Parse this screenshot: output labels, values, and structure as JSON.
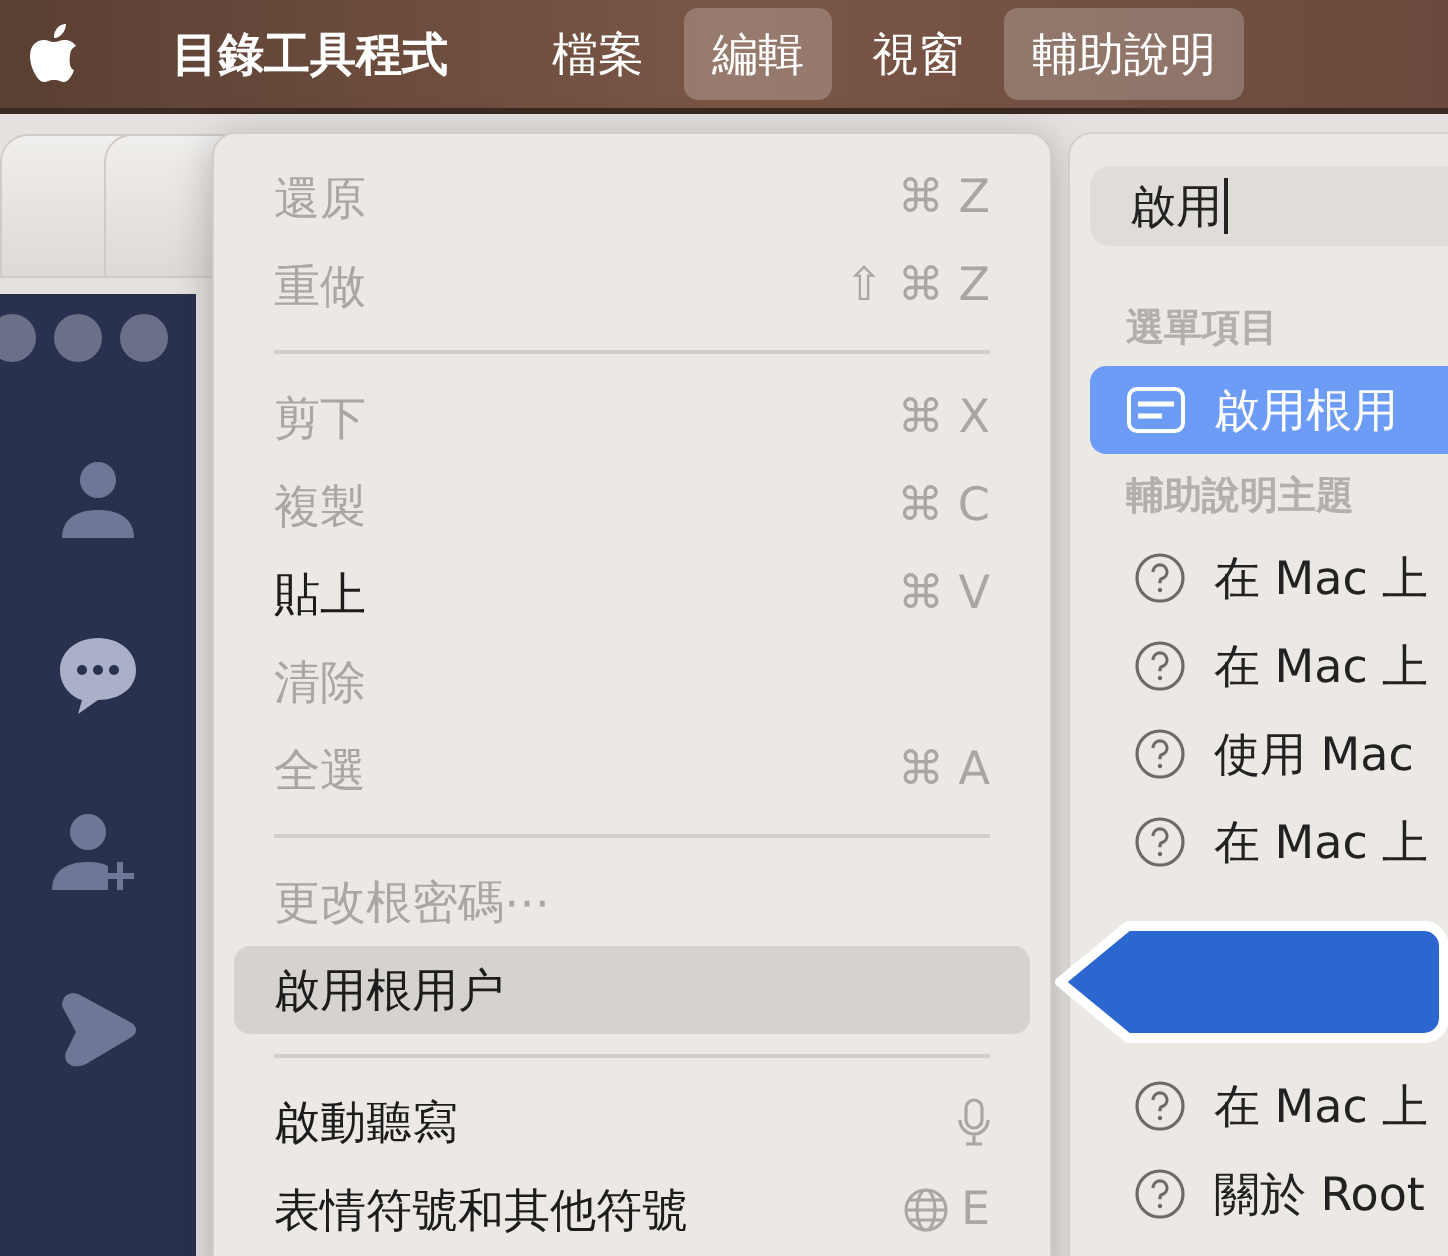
{
  "menu_bar": {
    "items": [
      {
        "label": "目錄工具程式",
        "kind": "app",
        "selected": false
      },
      {
        "label": "檔案",
        "kind": "menu",
        "selected": false
      },
      {
        "label": "編輯",
        "kind": "menu",
        "selected": true
      },
      {
        "label": "視窗",
        "kind": "menu",
        "selected": false
      },
      {
        "label": "輔助說明",
        "kind": "menu",
        "selected": true
      }
    ]
  },
  "edit_menu": {
    "items": [
      {
        "kind": "item",
        "label": "還原",
        "shortcut": "⌘ Z",
        "disabled": true,
        "highlighted": false
      },
      {
        "kind": "item",
        "label": "重做",
        "shortcut": "⇧ ⌘ Z",
        "disabled": true,
        "highlighted": false
      },
      {
        "kind": "separator"
      },
      {
        "kind": "item",
        "label": "剪下",
        "shortcut": "⌘ X",
        "disabled": true,
        "highlighted": false
      },
      {
        "kind": "item",
        "label": "複製",
        "shortcut": "⌘ C",
        "disabled": true,
        "highlighted": false
      },
      {
        "kind": "item",
        "label": "貼上",
        "shortcut": "⌘ V",
        "disabled": false,
        "highlighted": false
      },
      {
        "kind": "item",
        "label": "清除",
        "disabled": true,
        "highlighted": false
      },
      {
        "kind": "item",
        "label": "全選",
        "shortcut": "⌘ A",
        "disabled": true,
        "highlighted": false
      },
      {
        "kind": "separator"
      },
      {
        "kind": "item",
        "label": "更改根密碼⋯",
        "disabled": true,
        "highlighted": false
      },
      {
        "kind": "item",
        "label": "啟用根用户",
        "disabled": false,
        "highlighted": true
      },
      {
        "kind": "separator"
      },
      {
        "kind": "mic_item",
        "label": "啟動聽寫",
        "disabled": false,
        "highlighted": false
      },
      {
        "kind": "globe_item",
        "label": "表情符號和其他符號",
        "shortcut": "E",
        "disabled": false,
        "highlighted": false
      }
    ]
  },
  "help_panel": {
    "search": {
      "value": "啟用"
    },
    "menu_items_heading": "選單項目",
    "menu_results": [
      {
        "label": "啟用根用",
        "selected": true
      }
    ],
    "topics_heading": "輔助說明主題",
    "topics_above": [
      {
        "label": "在 Mac 上"
      },
      {
        "label": "在 Mac 上"
      },
      {
        "label": "使用 Mac"
      },
      {
        "label": "在 Mac 上"
      }
    ],
    "topics_below": [
      {
        "label": "在 Mac 上"
      },
      {
        "label": "關於 Root"
      }
    ]
  }
}
